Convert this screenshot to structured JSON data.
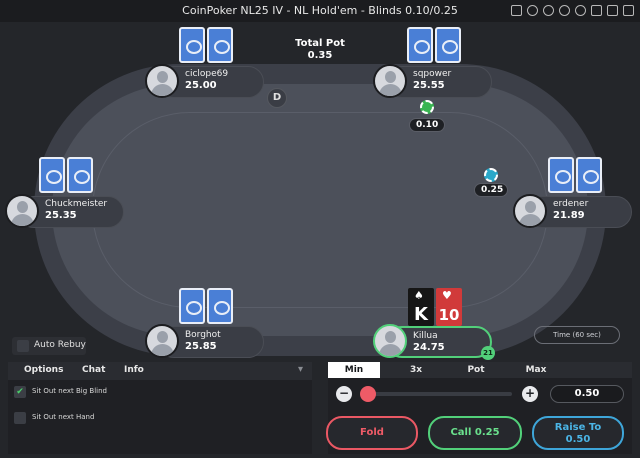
{
  "window": {
    "title": "CoinPoker NL25 IV - NL Hold'em - Blinds 0.10/0.25"
  },
  "pot": {
    "label": "Total Pot",
    "value": "0.35"
  },
  "dealer_button": "D",
  "seats": {
    "ciclope": {
      "name": "ciclope69",
      "stack": "25.00"
    },
    "sqpower": {
      "name": "sqpower",
      "stack": "25.55",
      "bet": "0.10"
    },
    "chuck": {
      "name": "Chuckmeister",
      "stack": "25.35"
    },
    "erdener": {
      "name": "erdener",
      "stack": "21.89",
      "bet": "0.25"
    },
    "borghot": {
      "name": "Borghot",
      "stack": "25.85"
    },
    "hero": {
      "name": "Killua",
      "stack": "24.75",
      "timer": "21"
    }
  },
  "hero_cards": [
    {
      "rank": "K",
      "suit": "♠",
      "color": "#161616"
    },
    {
      "rank": "10",
      "suit": "♥",
      "color": "#d13a3a"
    }
  ],
  "timebank_label": "Time (60 sec)",
  "auto_rebuy_label": "Auto Rebuy",
  "panel_tabs": [
    "Options",
    "Chat",
    "Info"
  ],
  "options": [
    {
      "label": "Sit Out next Big Blind",
      "checked": true
    },
    {
      "label": "Sit Out next Hand",
      "checked": false
    }
  ],
  "bet_sizes": [
    "Min",
    "3x",
    "Pot",
    "Max"
  ],
  "raise_amount": "0.50",
  "actions": {
    "fold": "Fold",
    "call": "Call 0.25",
    "raise_line1": "Raise To",
    "raise_line2": "0.50"
  },
  "colors": {
    "fold": "#ee5b67",
    "call": "#6ae08d",
    "raise": "#4bb5e6",
    "card_back": "#4a7fd6",
    "active_seat": "#52d07a"
  }
}
